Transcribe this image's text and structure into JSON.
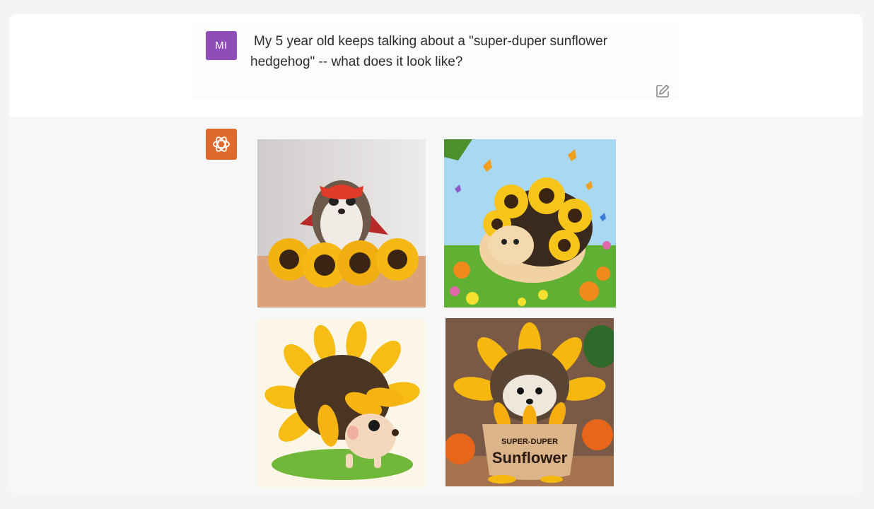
{
  "user_message": {
    "avatar_initials": "MI",
    "text": "My 5 year old keeps talking about a \"super-duper sunflower hedgehog\" -- what does it look like?",
    "edit_icon": "edit-icon"
  },
  "assistant_message": {
    "avatar_icon": "openai-logo-icon",
    "images": [
      {
        "label": "generated-image-1"
      },
      {
        "label": "generated-image-2"
      },
      {
        "label": "generated-image-3"
      },
      {
        "label": "generated-image-4",
        "pot_text_line1": "SUPER-DUPER",
        "pot_text_line2": "Sunflower"
      }
    ]
  },
  "colors": {
    "user_avatar": "#8e4db8",
    "assistant_avatar": "#e06a2c"
  }
}
